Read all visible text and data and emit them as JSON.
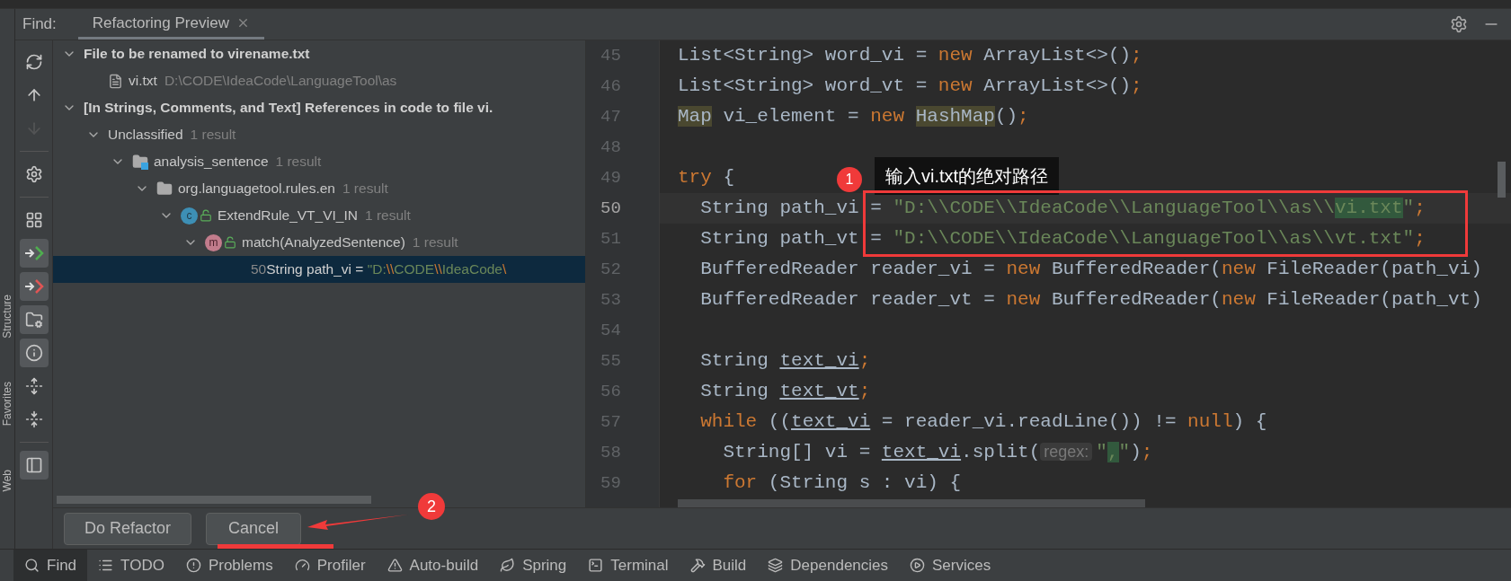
{
  "find_label": "Find:",
  "tabs": [
    {
      "label": "Refactoring Preview",
      "selected": true
    }
  ],
  "side_labels": [
    "Structure",
    "Favorites",
    "Web"
  ],
  "tools": [
    {
      "kind": "refresh",
      "boxed": false,
      "disabled": false
    },
    {
      "kind": "up",
      "boxed": false,
      "disabled": false
    },
    {
      "kind": "down",
      "boxed": false,
      "disabled": true
    },
    {
      "kind": "separator"
    },
    {
      "kind": "settings",
      "boxed": false,
      "disabled": false
    },
    {
      "kind": "separator"
    },
    {
      "kind": "group",
      "boxed": false,
      "disabled": false
    },
    {
      "kind": "include",
      "boxed": true,
      "disabled": false
    },
    {
      "kind": "exclude",
      "boxed": true,
      "disabled": false
    },
    {
      "kind": "folder",
      "boxed": true,
      "disabled": false
    },
    {
      "kind": "info",
      "boxed": true,
      "disabled": false
    },
    {
      "kind": "expand",
      "boxed": false,
      "disabled": false
    },
    {
      "kind": "collapse",
      "boxed": false,
      "disabled": false
    },
    {
      "kind": "separator"
    },
    {
      "kind": "panel",
      "boxed": true,
      "disabled": false
    }
  ],
  "tree": [
    {
      "kind": "group",
      "label": "File to be renamed to virename.txt",
      "expanded": true,
      "selected": false,
      "children": [
        {
          "kind": "file",
          "label": "vi.txt",
          "detail": "D:\\CODE\\IdeaCode\\LanguageTool\\as",
          "selected": false
        }
      ]
    },
    {
      "kind": "group",
      "label": "[In Strings, Comments, and Text] References in code to file vi.",
      "expanded": true,
      "selected": false,
      "children": [
        {
          "kind": "category",
          "label": "Unclassified",
          "detail": "1 result",
          "expanded": true,
          "selected": false,
          "children": [
            {
              "kind": "module",
              "label": "analysis_sentence",
              "detail": "1 result",
              "expanded": true,
              "selected": false,
              "children": [
                {
                  "kind": "package",
                  "label": "org.languagetool.rules.en",
                  "detail": "1 result",
                  "expanded": true,
                  "selected": false,
                  "children": [
                    {
                      "kind": "class",
                      "badge": "c",
                      "label": "ExtendRule_VT_VI_IN",
                      "detail": "1 result",
                      "expanded": true,
                      "selected": false,
                      "children": [
                        {
                          "kind": "method",
                          "badge": "m",
                          "label": "match(AnalyzedSentence)",
                          "detail": "1 result",
                          "expanded": true,
                          "selected": false,
                          "children": [
                            {
                              "kind": "usage",
                              "line": "50",
                              "selected": true,
                              "segments": [
                                {
                                  "text": " String path_vi = ",
                                  "kind": "plain"
                                },
                                {
                                  "text": "\"D:",
                                  "kind": "string"
                                },
                                {
                                  "text": "\\\\",
                                  "kind": "escape"
                                },
                                {
                                  "text": "CODE",
                                  "kind": "string"
                                },
                                {
                                  "text": "\\\\",
                                  "kind": "escape"
                                },
                                {
                                  "text": "IdeaCode",
                                  "kind": "string"
                                },
                                {
                                  "text": "\\",
                                  "kind": "escape"
                                }
                              ]
                            }
                          ]
                        }
                      ]
                    }
                  ]
                }
              ]
            }
          ]
        }
      ]
    }
  ],
  "buttons": [
    {
      "label": "Do Refactor"
    },
    {
      "label": "Cancel"
    }
  ],
  "code": [
    {
      "number": "45",
      "current": false,
      "segments": [
        {
          "text": "List<String> word_vi = ",
          "kind": "plain"
        },
        {
          "text": "new",
          "kind": "keyword"
        },
        {
          "text": " ArrayList<>()",
          "kind": "plain"
        },
        {
          "text": ";",
          "kind": "keyword"
        }
      ]
    },
    {
      "number": "46",
      "current": false,
      "segments": [
        {
          "text": "List<String> word_vt = ",
          "kind": "plain"
        },
        {
          "text": "new",
          "kind": "keyword"
        },
        {
          "text": " ArrayList<>()",
          "kind": "plain"
        },
        {
          "text": ";",
          "kind": "keyword"
        }
      ]
    },
    {
      "number": "47",
      "current": false,
      "segments": [
        {
          "text": "Map",
          "kind": "highlight"
        },
        {
          "text": " vi_element = ",
          "kind": "plain"
        },
        {
          "text": "new ",
          "kind": "keyword"
        },
        {
          "text": "HashMap",
          "kind": "highlight"
        },
        {
          "text": "()",
          "kind": "plain"
        },
        {
          "text": ";",
          "kind": "keyword"
        }
      ]
    },
    {
      "number": "48",
      "current": false
    },
    {
      "number": "49",
      "current": false,
      "segments": [
        {
          "text": "try",
          "kind": "keyword"
        },
        {
          "text": " {",
          "kind": "plain"
        }
      ]
    },
    {
      "number": "50",
      "current": true,
      "segments": [
        {
          "text": "  String path_vi = ",
          "kind": "plain"
        },
        {
          "text": "\"D:\\\\CODE\\\\IdeaCode\\\\LanguageTool\\\\as\\\\",
          "kind": "string"
        },
        {
          "text": "vi.txt",
          "kind": "match"
        },
        {
          "text": "\"",
          "kind": "string"
        },
        {
          "text": ";",
          "kind": "keyword"
        }
      ]
    },
    {
      "number": "51",
      "current": false,
      "segments": [
        {
          "text": "  String path_vt = ",
          "kind": "plain"
        },
        {
          "text": "\"D:\\\\CODE\\\\IdeaCode\\\\LanguageTool\\\\as\\\\vt.txt\"",
          "kind": "string"
        },
        {
          "text": ";",
          "kind": "keyword"
        }
      ]
    },
    {
      "number": "52",
      "current": false,
      "segments": [
        {
          "text": "  BufferedReader reader_vi = ",
          "kind": "plain"
        },
        {
          "text": "new",
          "kind": "keyword"
        },
        {
          "text": " BufferedReader(",
          "kind": "plain"
        },
        {
          "text": "new",
          "kind": "keyword"
        },
        {
          "text": " FileReader(path_vi)",
          "kind": "plain"
        }
      ]
    },
    {
      "number": "53",
      "current": false,
      "segments": [
        {
          "text": "  BufferedReader reader_vt = ",
          "kind": "plain"
        },
        {
          "text": "new",
          "kind": "keyword"
        },
        {
          "text": " BufferedReader(",
          "kind": "plain"
        },
        {
          "text": "new",
          "kind": "keyword"
        },
        {
          "text": " FileReader(path_vt)",
          "kind": "plain"
        }
      ]
    },
    {
      "number": "54",
      "current": false
    },
    {
      "number": "55",
      "current": false,
      "segments": [
        {
          "text": "  String ",
          "kind": "plain"
        },
        {
          "text": "text_vi",
          "kind": "underline"
        },
        {
          "text": ";",
          "kind": "keyword"
        }
      ]
    },
    {
      "number": "56",
      "current": false,
      "segments": [
        {
          "text": "  String ",
          "kind": "plain"
        },
        {
          "text": "text_vt",
          "kind": "underline"
        },
        {
          "text": ";",
          "kind": "keyword"
        }
      ]
    },
    {
      "number": "57",
      "current": false,
      "segments": [
        {
          "text": "  while",
          "kind": "keyword"
        },
        {
          "text": " ((",
          "kind": "plain"
        },
        {
          "text": "text_vi",
          "kind": "underline"
        },
        {
          "text": " = reader_vi.readLine()) != ",
          "kind": "plain"
        },
        {
          "text": "null",
          "kind": "keyword"
        },
        {
          "text": ") {",
          "kind": "plain"
        }
      ]
    },
    {
      "number": "58",
      "current": false,
      "segments": [
        {
          "text": "    String[] vi = ",
          "kind": "plain"
        },
        {
          "text": "text_vi",
          "kind": "underline"
        },
        {
          "text": ".split(",
          "kind": "plain"
        },
        {
          "text": "regex:",
          "kind": "hint"
        },
        {
          "text": "\"",
          "kind": "string"
        },
        {
          "text": ",",
          "kind": "match"
        },
        {
          "text": "\"",
          "kind": "string"
        },
        {
          "text": ")",
          "kind": "plain"
        },
        {
          "text": ";",
          "kind": "keyword"
        }
      ]
    },
    {
      "number": "59",
      "current": false,
      "segments": [
        {
          "text": "    for",
          "kind": "keyword"
        },
        {
          "text": " (String s : vi) {",
          "kind": "plain"
        }
      ]
    }
  ],
  "annotations": [
    {
      "kind": "callout",
      "badge": "1",
      "label": "输入vi.txt的绝对路径"
    },
    {
      "kind": "arrow",
      "badge": "2"
    }
  ],
  "status_tabs": [
    {
      "kind": "find",
      "label": "Find",
      "selected": true
    },
    {
      "kind": "todo",
      "label": "TODO",
      "selected": false
    },
    {
      "kind": "problems",
      "label": "Problems",
      "selected": false
    },
    {
      "kind": "profiler",
      "label": "Profiler",
      "selected": false
    },
    {
      "kind": "autobuild",
      "label": "Auto-build",
      "selected": false
    },
    {
      "kind": "spring",
      "label": "Spring",
      "selected": false
    },
    {
      "kind": "terminal",
      "label": "Terminal",
      "selected": false
    },
    {
      "kind": "build",
      "label": "Build",
      "selected": false
    },
    {
      "kind": "dependencies",
      "label": "Dependencies",
      "selected": false
    },
    {
      "kind": "services",
      "label": "Services",
      "selected": false
    }
  ]
}
